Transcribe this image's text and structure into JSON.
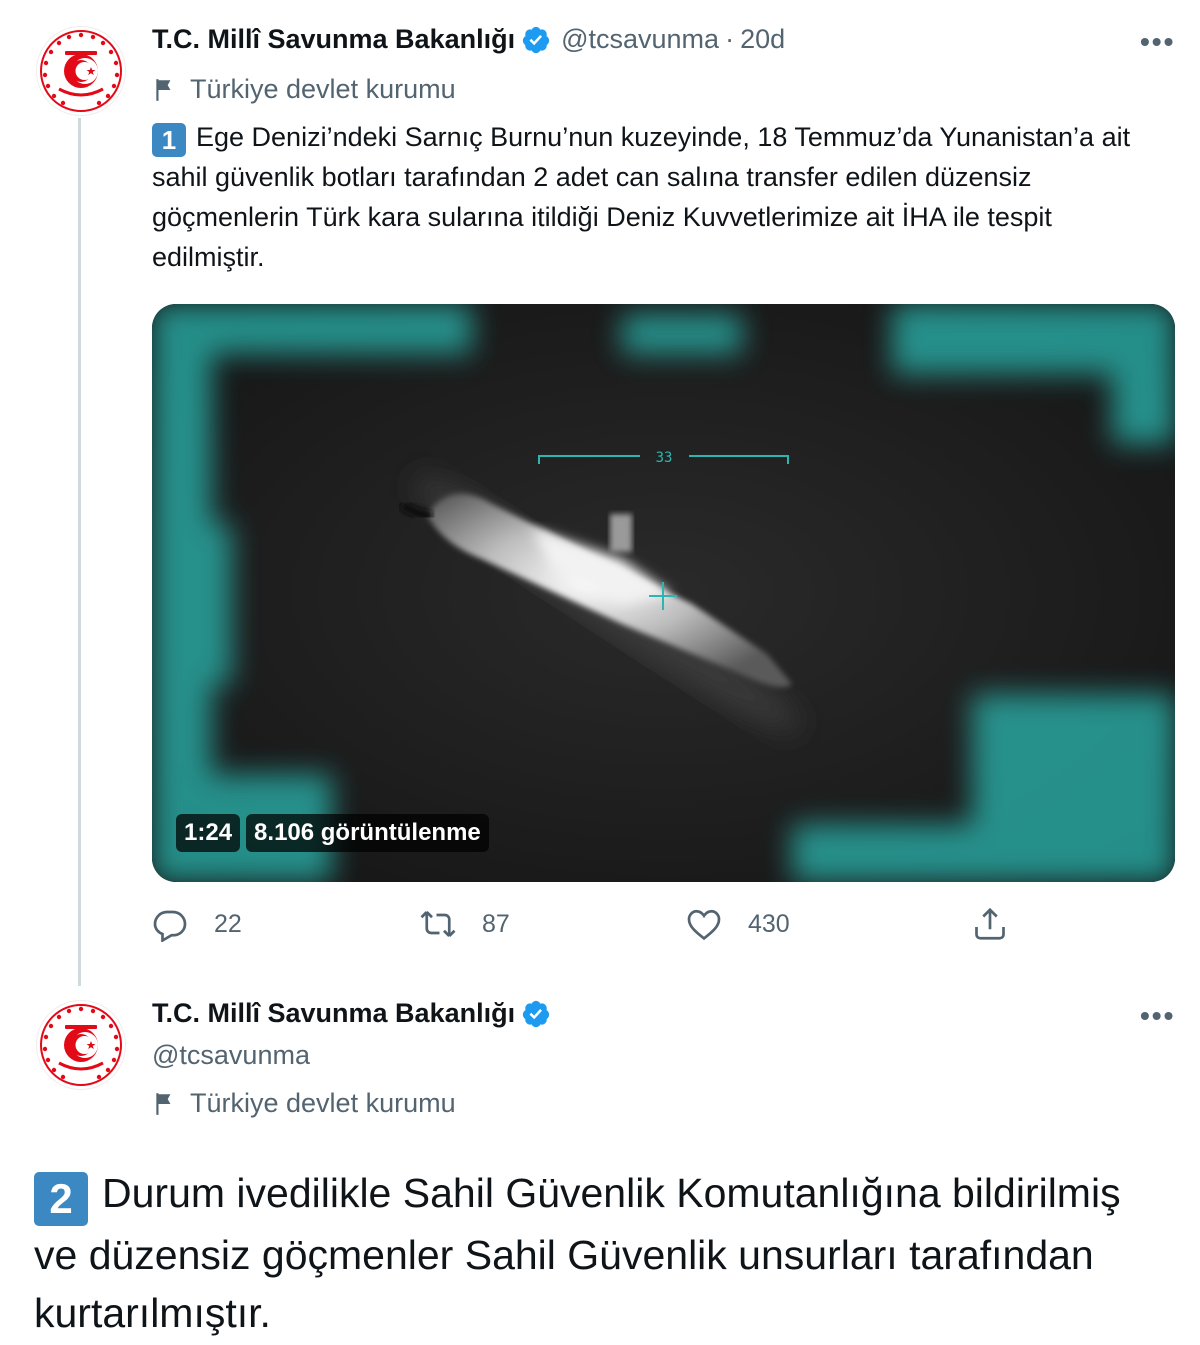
{
  "tweet1": {
    "author_name": "T.C. Millî Savunma Bakanlığı",
    "handle": "@tcsavunma",
    "separator": "·",
    "age": "20d",
    "more": "•••",
    "label": "Türkiye devlet kurumu",
    "number_emoji": "1",
    "text": "Ege Denizi’ndeki Sarnıç Burnu’nun kuzeyinde, 18 Temmuz’da Yunanistan’a ait sahil güvenlik botları tarafından 2 adet can salına transfer edilen düzensiz göçmenlerin Türk kara sularına itildiği Deniz Kuvvetlerimize ait İHA ile tespit edilmiştir.",
    "video": {
      "hud_heading": "33",
      "duration": "1:24",
      "views": "8.106 görüntülenme"
    },
    "actions": {
      "replies": "22",
      "retweets": "87",
      "likes": "430"
    }
  },
  "tweet2": {
    "author_name": "T.C. Millî Savunma Bakanlığı",
    "handle": "@tcsavunma",
    "more": "•••",
    "label": "Türkiye devlet kurumu",
    "number_emoji": "2",
    "text": "Durum ivedilikle Sahil Güvenlik Komutanlığına bildirilmiş ve düzensiz göçmenler Sahil Güvenlik unsurları tarafından kurtarılmıştır."
  },
  "colors": {
    "text_primary": "#0f1419",
    "text_secondary": "#536471",
    "verified_blue": "#1d9bf0",
    "keycap_blue": "#3b88c3",
    "emblem_red": "#e30a17",
    "thread_line": "#cfd9de",
    "hud_teal": "#2bb7b0"
  },
  "icons": [
    "verified-badge-icon",
    "flag-icon",
    "reply-icon",
    "retweet-icon",
    "like-icon",
    "share-icon",
    "more-icon",
    "play-video"
  ]
}
